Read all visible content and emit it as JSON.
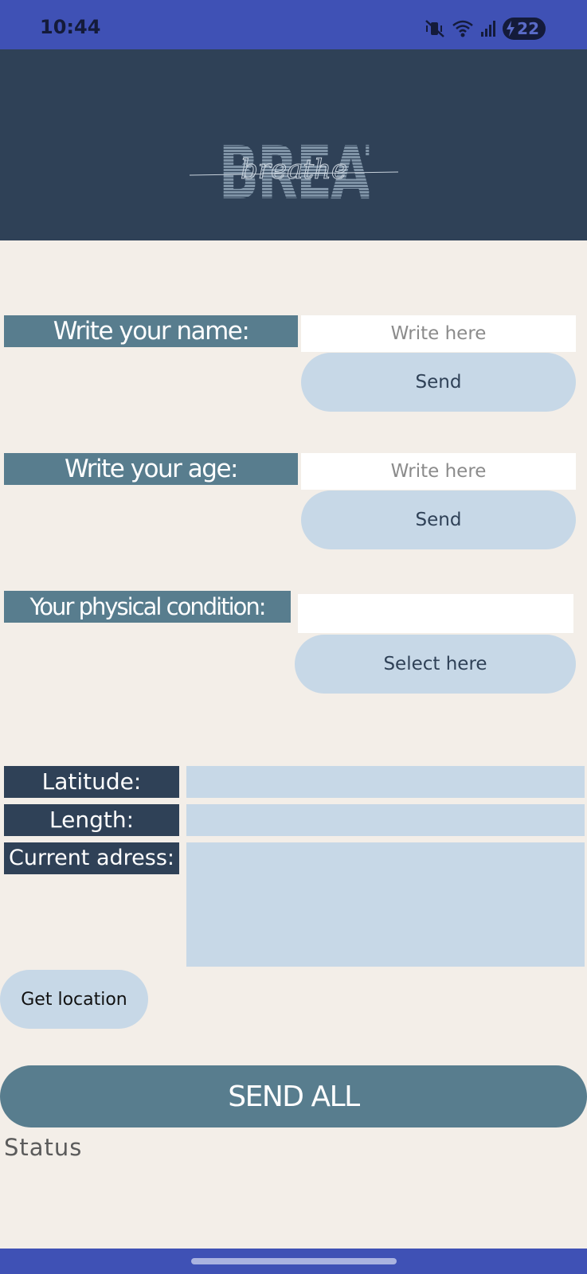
{
  "status_bar": {
    "time": "10:44",
    "battery": "22",
    "icons": [
      "vibrate-mute-icon",
      "wifi-icon",
      "signal-icon",
      "battery-charging-icon"
    ]
  },
  "header": {
    "logo_text": "BREATHE",
    "logo_script": "breathe"
  },
  "form": {
    "name": {
      "label": "Write your name:",
      "placeholder": "Write here",
      "value": "",
      "button": "Send"
    },
    "age": {
      "label": "Write your age:",
      "placeholder": "Write here",
      "value": "",
      "button": "Send"
    },
    "condition": {
      "label": "Your physical condition:",
      "value": "",
      "button": "Select here"
    }
  },
  "location": {
    "latitude_label": "Latitude:",
    "length_label": "Length:",
    "address_label": "Current adress:",
    "latitude_value": "",
    "length_value": "",
    "address_value": "",
    "get_button": "Get location"
  },
  "send_all_label": "SEND ALL",
  "status_label": "Status",
  "colors": {
    "status_bar": "#3f51b5",
    "header": "#2f4157",
    "background": "#f3eee8",
    "label": "#587d8e",
    "pill": "#c7d8e7"
  }
}
